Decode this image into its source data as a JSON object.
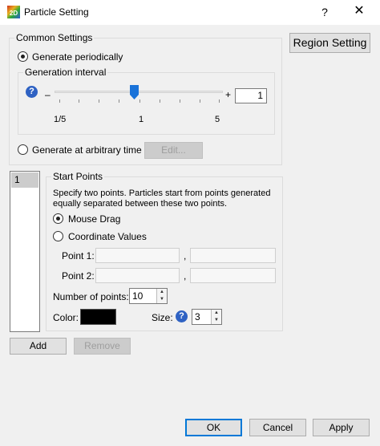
{
  "window": {
    "title": "Particle Setting",
    "help": "?",
    "close": "✕",
    "app_icon_text": "2D"
  },
  "common": {
    "legend": "Common Settings",
    "generate_periodically": "Generate periodically",
    "interval": {
      "legend": "Generation interval",
      "minus": "–",
      "plus": "+",
      "value": "1",
      "labels": [
        "1/5",
        "1",
        "5"
      ]
    },
    "generate_arbitrary": "Generate at arbitrary time",
    "edit": "Edit..."
  },
  "region_button": "Region Setting",
  "list": {
    "items": [
      "1"
    ]
  },
  "start": {
    "legend": "Start Points",
    "description": "Specify two points. Particles start from points generated equally separated between these two points.",
    "mouse_drag": "Mouse Drag",
    "coordinate_values": "Coordinate Values",
    "point1": "Point 1:",
    "point2": "Point 2:",
    "comma": ",",
    "num_points_label": "Number of points:",
    "num_points": "10",
    "color_label": "Color:",
    "color": "#000000",
    "size_label": "Size:",
    "size": "3"
  },
  "add": "Add",
  "remove": "Remove",
  "ok": "OK",
  "cancel": "Cancel",
  "apply": "Apply",
  "slider_position": 0.4
}
